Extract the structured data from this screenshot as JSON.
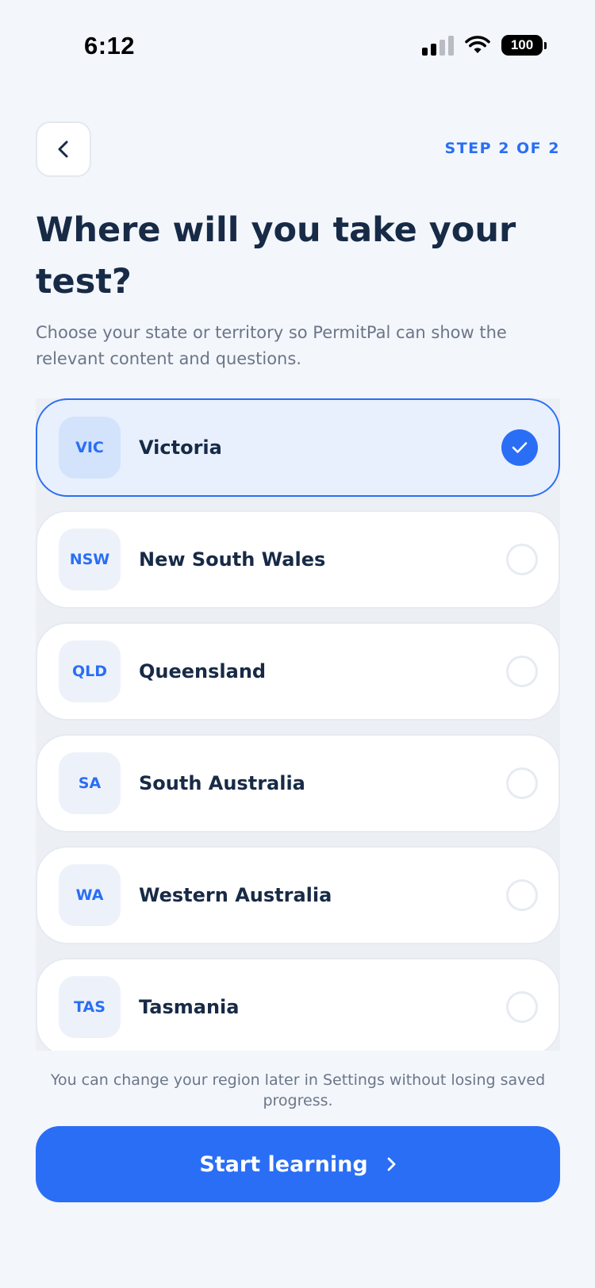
{
  "status_bar": {
    "time": "6:12",
    "battery": "100"
  },
  "header": {
    "back_icon": "chevron-left-icon",
    "step": "STEP 2 OF 2"
  },
  "title": "Where will you take your test?",
  "subtitle": "Choose your state or territory so PermitPal can show the relevant content and questions.",
  "states": [
    {
      "code": "VIC",
      "name": "Victoria",
      "selected": true
    },
    {
      "code": "NSW",
      "name": "New South Wales",
      "selected": false
    },
    {
      "code": "QLD",
      "name": "Queensland",
      "selected": false
    },
    {
      "code": "SA",
      "name": "South Australia",
      "selected": false
    },
    {
      "code": "WA",
      "name": "Western Australia",
      "selected": false
    },
    {
      "code": "TAS",
      "name": "Tasmania",
      "selected": false
    }
  ],
  "footnote": "You can change your region later in Settings without losing saved progress.",
  "cta": {
    "label": "Start learning",
    "icon": "chevron-right-icon"
  },
  "colors": {
    "accent": "#2a6ef5",
    "text": "#172a46",
    "muted": "#6b7688",
    "background": "#f3f6fb"
  }
}
